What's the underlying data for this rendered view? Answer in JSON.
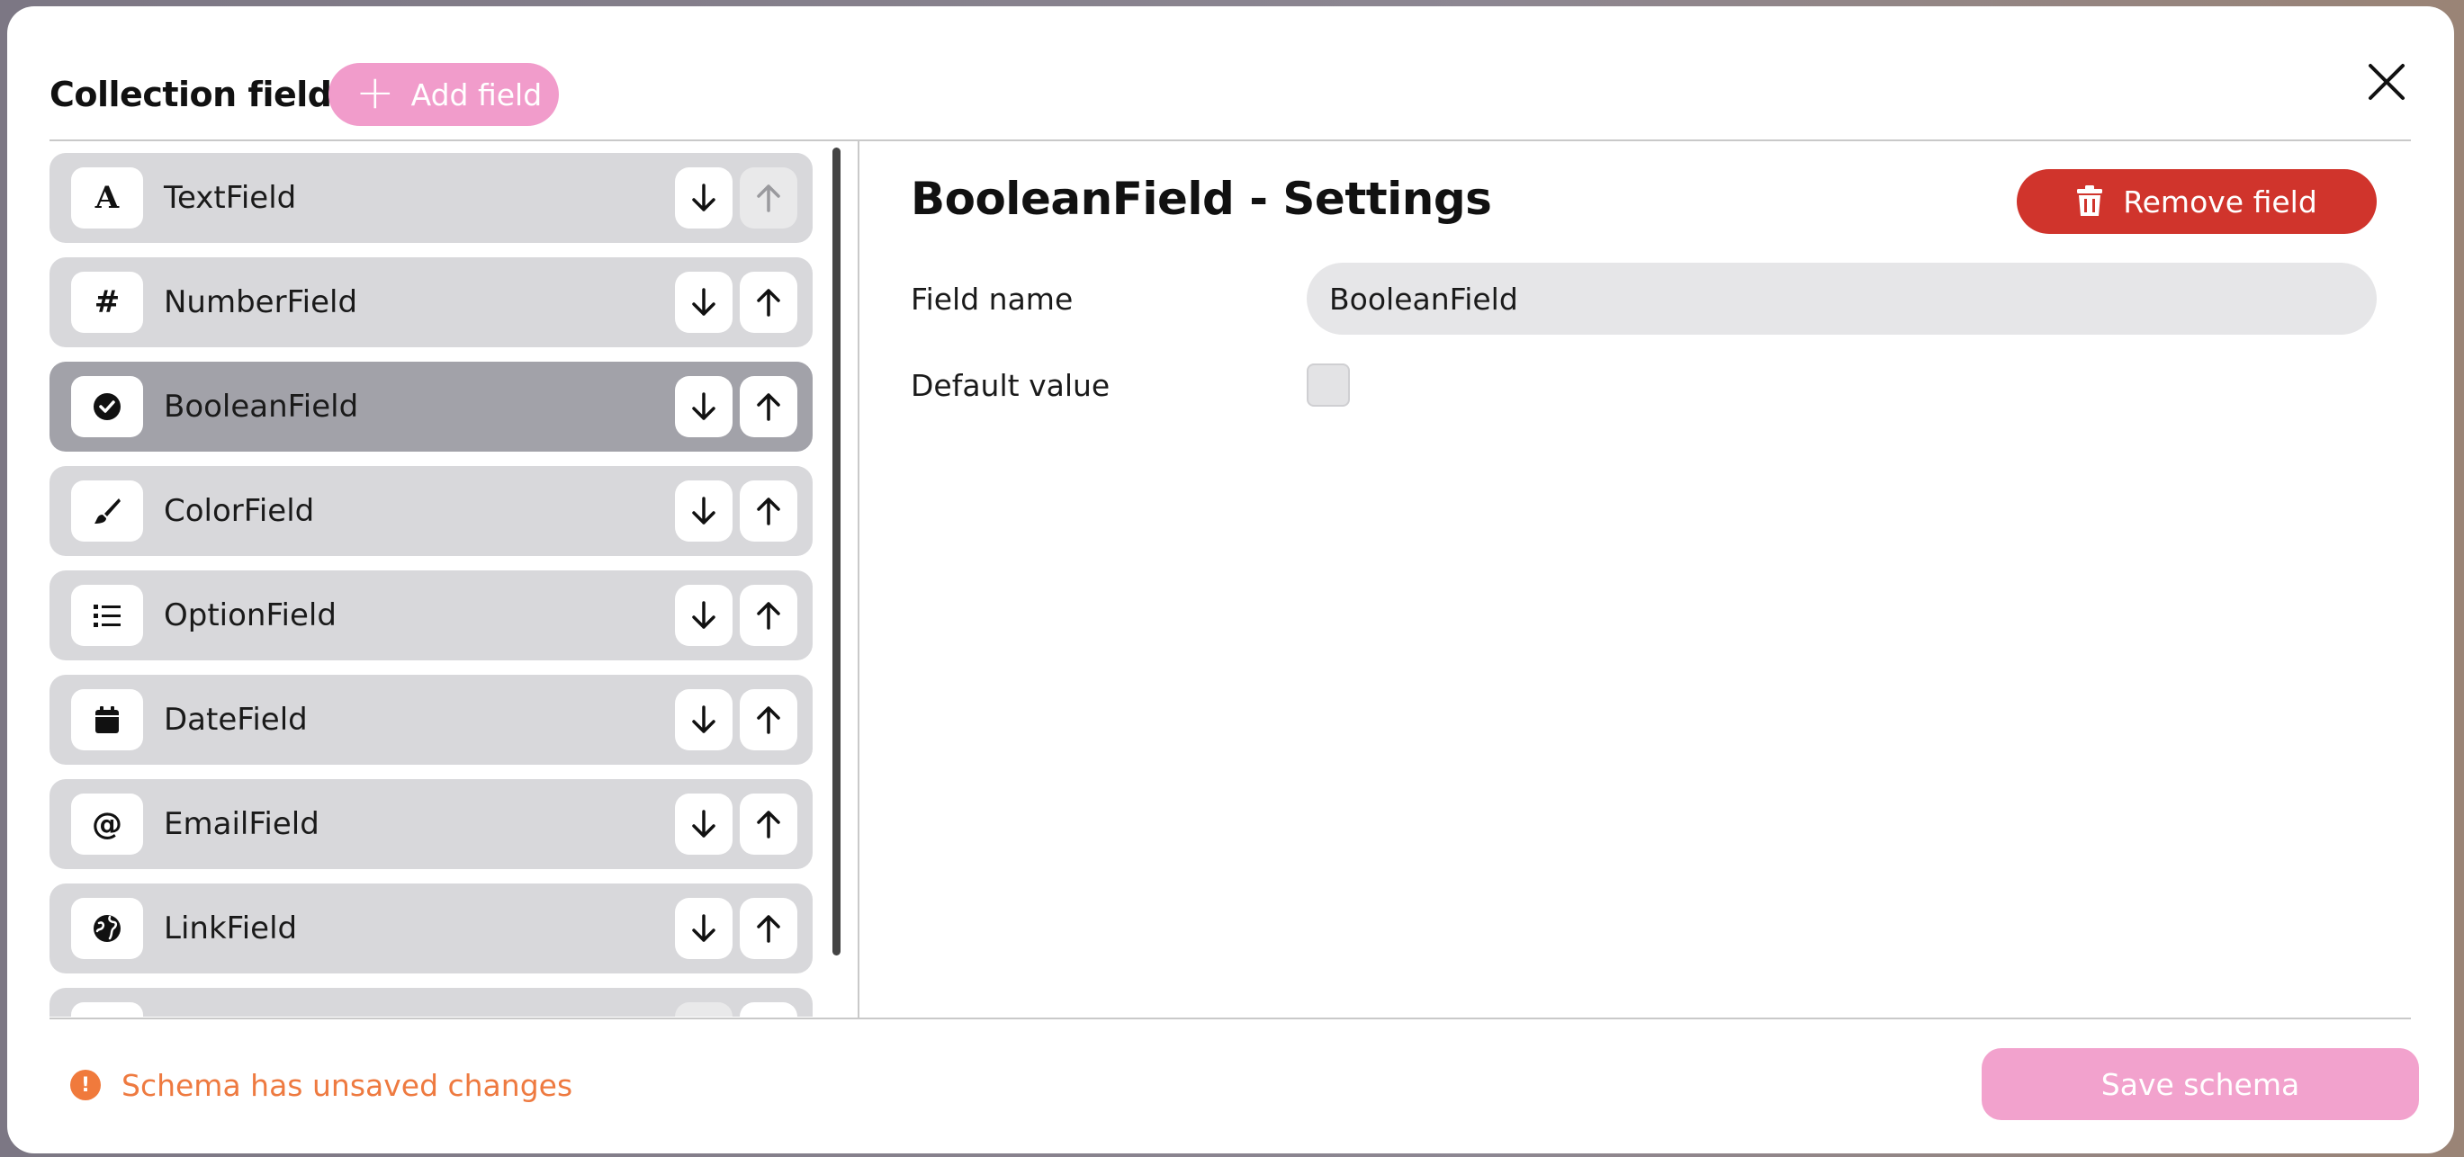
{
  "header": {
    "title": "Collection fields",
    "add_field_label": "Add field"
  },
  "fields": [
    {
      "name": "TextField",
      "icon": "text-icon",
      "up_disabled": true
    },
    {
      "name": "NumberField",
      "icon": "hash-icon"
    },
    {
      "name": "BooleanField",
      "icon": "check-circle-icon",
      "selected": true
    },
    {
      "name": "ColorField",
      "icon": "brush-icon"
    },
    {
      "name": "OptionField",
      "icon": "list-icon"
    },
    {
      "name": "DateField",
      "icon": "calendar-icon"
    },
    {
      "name": "EmailField",
      "icon": "at-icon"
    },
    {
      "name": "LinkField",
      "icon": "globe-icon"
    }
  ],
  "settings": {
    "title": "BooleanField - Settings",
    "remove_label": "Remove field",
    "field_name_label": "Field name",
    "field_name_value": "BooleanField",
    "default_value_label": "Default value",
    "default_value_checked": false
  },
  "footer": {
    "warning": "Schema has unsaved changes",
    "save_label": "Save schema"
  },
  "colors": {
    "accent_pink": "#f19ccb",
    "danger_red": "#d0342c",
    "warning_orange": "#ee7a40"
  }
}
